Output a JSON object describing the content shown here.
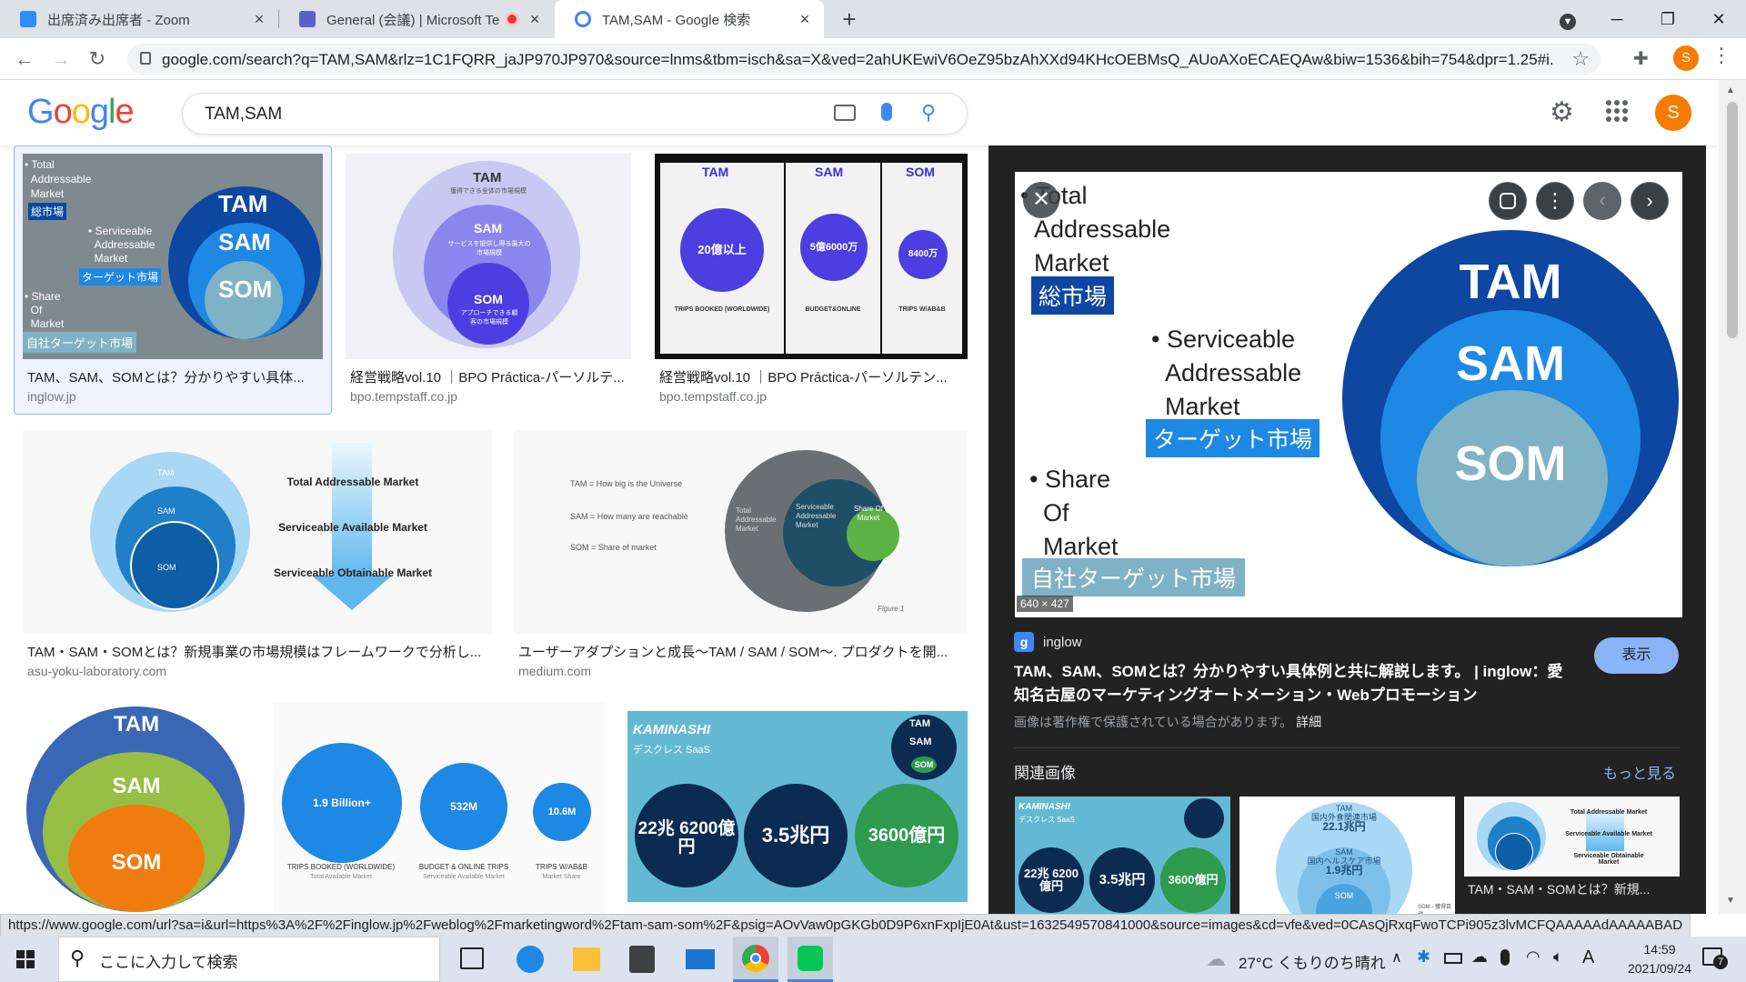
{
  "browser": {
    "tabs": [
      {
        "title": "出席済み出席者 - Zoom",
        "icon_color": "#2d8cff"
      },
      {
        "title": "General (会議) | Microsoft Te",
        "icon_color": "#5b5fc7"
      },
      {
        "title": "TAM,SAM - Google 検索",
        "icon_color": "#4285f4"
      }
    ],
    "new_tab": "+",
    "url": "google.com/search?q=TAM,SAM&rlz=1C1FQRR_jaJP970JP970&source=lnms&tbm=isch&sa=X&ved=2ahUKEwiV6OeZ95bzAhXXd94KHcOEBMsQ_AUoAXoECAEQAw&biw=1536&bih=754&dpr=1.25#i...",
    "profile_initial": "S"
  },
  "google": {
    "logo": "Google",
    "query": "TAM,SAM",
    "profile_initial": "S"
  },
  "results": [
    {
      "caption": "TAM、SAM、SOMとは？分かりやすい具体...",
      "source": "inglow.jp",
      "lines": [
        "Total",
        "Addressable",
        "Market",
        "総市場",
        "Serviceable",
        "Addressable",
        "Market",
        "ターゲット市場",
        "Share",
        "Of",
        "Market",
        "自社ターゲット市場"
      ],
      "circles": [
        "TAM",
        "SAM",
        "SOM"
      ]
    },
    {
      "caption": "経営戦略vol.10 ｜BPO Práctica-パーソルテ...",
      "source": "bpo.tempstaff.co.jp",
      "circles": [
        "TAM",
        "SAM",
        "SOM"
      ],
      "sub": [
        "獲得できる全体の市場規模",
        "サービスを提供し得る最大の市場規模",
        "アプローチできる顧客の市場規模"
      ]
    },
    {
      "caption": "経営戦略vol.10 ｜BPO Práctica-パーソルテン...",
      "source": "bpo.tempstaff.co.jp",
      "cols": [
        "TAM",
        "SAM",
        "SOM"
      ],
      "values": [
        "20億以上",
        "5億6000万",
        "8400万"
      ],
      "foot": [
        "TRIPS BOOKED (WORLDWIDE)",
        "BUDGET&ONLINE",
        "TRIPS W/AB&B"
      ]
    },
    {
      "caption": "TAM・SAM・SOMとは？新規事業の市場規模はフレームワークで分析し...",
      "source": "asu-yoku-laboratory.com",
      "circles": [
        "TAM",
        "SAM",
        "SOM"
      ],
      "labels": [
        "Total Addressable Market",
        "Serviceable Available Market",
        "Serviceable Obtainable Market"
      ]
    },
    {
      "caption": "ユーザーアダプションと成長〜TAM / SAM / SOM〜. プロダクトを開...",
      "source": "medium.com",
      "lines": [
        "TAM = How big is the Universe",
        "SAM = How many are reachable",
        "SOM = Share of market"
      ],
      "circle_labels": [
        "Total Addressable Market",
        "Serviceable Addressable Market",
        "Share Of Market"
      ],
      "fig": "Figure 1"
    },
    {
      "circles": [
        "TAM",
        "SAM",
        "SOM"
      ]
    },
    {
      "values": [
        "1.9 Billion+",
        "532M",
        "10.6M"
      ],
      "foot": [
        "TRIPS BOOKED (WORLDWIDE)",
        "BUDGET & ONLINE TRIPS",
        "TRIPS W/AB&B"
      ],
      "sub": [
        "Total Available Market",
        "Serviceable Available Market",
        "Market Share"
      ]
    },
    {
      "brand": "KAMINASHI",
      "sub": "デスクレス SaaS",
      "circles": [
        "TAM",
        "SAM",
        "SOM"
      ],
      "values": [
        "22兆 6200億円",
        "3.5兆円",
        "3600億円"
      ]
    }
  ],
  "panel": {
    "image_labels": {
      "tam_lines": [
        "Total",
        "Addressable",
        "Market"
      ],
      "tam_jp": "総市場",
      "sam_lines": [
        "Serviceable",
        "Addressable",
        "Market"
      ],
      "sam_jp": "ターゲット市場",
      "som_lines": [
        "Share",
        "Of",
        "Market"
      ],
      "som_jp": "自社ターゲット市場",
      "circles": [
        "TAM",
        "SAM",
        "SOM"
      ]
    },
    "dims": "640 × 427",
    "site": "inglow",
    "visit_button": "表示",
    "title": "TAM、SAM、SOMとは？分かりやすい具体例と共に解説します。 | inglow：愛知名古屋のマーケティングオートメーション・Webプロモーション",
    "copyright": "画像は著作権で保護されている場合があります。",
    "details": "詳細",
    "related_heading": "関連画像",
    "see_more": "もっと見る",
    "related": [
      {
        "brand": "KAMINASHI",
        "sub": "デスクレス SaaS",
        "values": [
          "22兆 6200億円",
          "3.5兆円",
          "3600億円"
        ]
      },
      {
        "labels": [
          "TAM",
          "国内外食関連市場",
          "22.1兆円",
          "SAM",
          "国内ヘルスケア市場",
          "1.9兆円",
          "SOM",
          "SOM - 獲得目標"
        ]
      },
      {
        "labels": [
          "Total Addressable Market",
          "Serviceable Available Market",
          "Serviceable Obtainable Market"
        ],
        "caption": "TAM・SAM・SOMとは？新規..."
      }
    ]
  },
  "status_url": "https://www.google.com/url?sa=i&url=https%3A%2F%2Finglow.jp%2Fweblog%2Fmarketingword%2Ftam-sam-som%2F&psig=AOvVaw0pGKGb0D9P6xnFxpIjE0At&ust=1632549570841000&source=images&cd=vfe&ved=0CAsQjRxqFwoTCPi905z3lvMCFQAAAAAdAAAAABAD",
  "taskbar": {
    "search_placeholder": "ここに入力して検索",
    "weather": "27°C くもりのち晴れ",
    "ime": "A",
    "time": "14:59",
    "date": "2021/09/24",
    "notif_count": "7"
  }
}
